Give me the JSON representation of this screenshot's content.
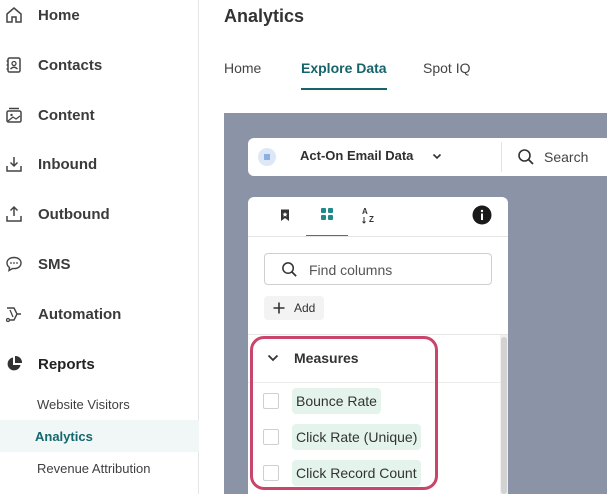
{
  "sidebar": {
    "items": [
      {
        "label": "Home",
        "icon": "home-icon"
      },
      {
        "label": "Contacts",
        "icon": "contacts-icon"
      },
      {
        "label": "Content",
        "icon": "content-icon"
      },
      {
        "label": "Inbound",
        "icon": "inbound-icon"
      },
      {
        "label": "Outbound",
        "icon": "outbound-icon"
      },
      {
        "label": "SMS",
        "icon": "sms-icon"
      },
      {
        "label": "Automation",
        "icon": "automation-icon"
      },
      {
        "label": "Reports",
        "icon": "reports-icon"
      }
    ],
    "sub_items": [
      {
        "label": "Website Visitors"
      },
      {
        "label": "Analytics"
      },
      {
        "label": "Revenue Attribution"
      }
    ]
  },
  "main": {
    "title": "Analytics",
    "tabs": [
      {
        "label": "Home"
      },
      {
        "label": "Explore Data"
      },
      {
        "label": "Spot IQ"
      }
    ]
  },
  "toolbar": {
    "datasource": "Act-On Email Data",
    "search_label": "Search"
  },
  "panel": {
    "find_placeholder": "Find columns",
    "add_label": "Add",
    "section_title": "Measures",
    "columns": [
      {
        "label": "Bounce Rate"
      },
      {
        "label": "Click Rate (Unique)"
      },
      {
        "label": "Click Record Count"
      }
    ]
  },
  "colors": {
    "accent": "#17636a",
    "canvas": "#8a94a6",
    "chip": "#e4f4ec",
    "highlight": "#c9456b"
  }
}
